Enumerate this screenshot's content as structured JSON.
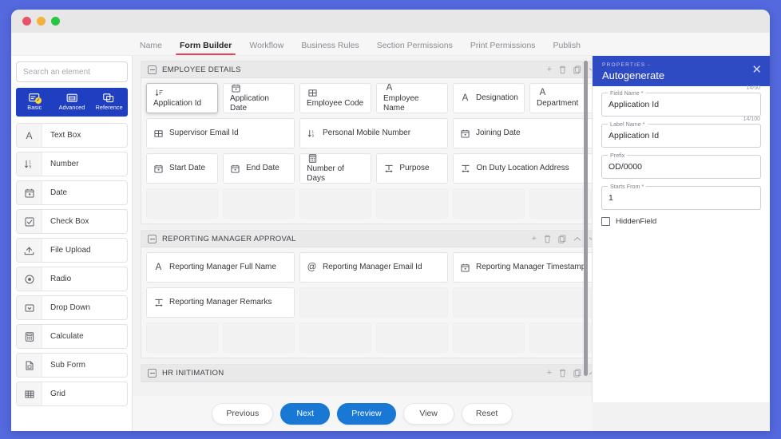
{
  "window": {
    "traffic_lights": [
      "close",
      "minimize",
      "maximize"
    ]
  },
  "tabs": [
    {
      "label": "Name",
      "active": false
    },
    {
      "label": "Form Builder",
      "active": true
    },
    {
      "label": "Workflow",
      "active": false
    },
    {
      "label": "Business Rules",
      "active": false
    },
    {
      "label": "Section Permissions",
      "active": false
    },
    {
      "label": "Print Permissions",
      "active": false
    },
    {
      "label": "Publish",
      "active": false
    }
  ],
  "sidebar": {
    "search": {
      "value": "",
      "placeholder": "Search an element"
    },
    "category_tabs": [
      {
        "label": "Basic",
        "icon": "basic-card-icon",
        "active": true,
        "badge": "✓"
      },
      {
        "label": "Advanced",
        "icon": "advanced-card-icon",
        "active": false
      },
      {
        "label": "Reference",
        "icon": "reference-card-icon",
        "active": false
      }
    ],
    "elements": [
      {
        "label": "Text Box",
        "icon": "letter-a-icon"
      },
      {
        "label": "Number",
        "icon": "number-sort-icon"
      },
      {
        "label": "Date",
        "icon": "calendar-icon"
      },
      {
        "label": "Check Box",
        "icon": "checkbox-icon"
      },
      {
        "label": "File Upload",
        "icon": "upload-icon"
      },
      {
        "label": "Radio",
        "icon": "radio-icon"
      },
      {
        "label": "Drop Down",
        "icon": "dropdown-icon"
      },
      {
        "label": "Calculate",
        "icon": "calculator-icon"
      },
      {
        "label": "Sub Form",
        "icon": "subform-icon"
      },
      {
        "label": "Grid",
        "icon": "grid-icon"
      }
    ]
  },
  "canvas": {
    "sections": [
      {
        "title": "EMPLOYEE DETAILS",
        "actions": [
          "add",
          "delete",
          "copy",
          "chevron-down"
        ],
        "rows": [
          [
            {
              "label": "Application Id",
              "icon": "number-sort-icon",
              "width": "w1",
              "selected": true,
              "stack": true
            },
            {
              "label": "Application Date",
              "icon": "calendar-icon",
              "width": "w1",
              "stack": true
            },
            {
              "label": "Employee Code",
              "icon": "grid-icon",
              "width": "w1",
              "stack": true
            },
            {
              "label": "Employee Name",
              "icon": "letter-a-icon",
              "width": "w1",
              "stack": true
            },
            {
              "label": "Designation",
              "icon": "letter-a-icon",
              "width": "w1"
            },
            {
              "label": "Department",
              "icon": "letter-a-icon",
              "width": "w1",
              "stack": true
            }
          ],
          [
            {
              "label": "Supervisor Email Id",
              "icon": "grid-icon",
              "width": "w2"
            },
            {
              "label": "Personal Mobile Number",
              "icon": "number-sort-icon",
              "width": "w2"
            },
            {
              "label": "Joining Date",
              "icon": "calendar-icon",
              "width": "w2"
            }
          ],
          [
            {
              "label": "Start Date",
              "icon": "calendar-icon",
              "width": "w1"
            },
            {
              "label": "End Date",
              "icon": "calendar-icon",
              "width": "w1"
            },
            {
              "label": "Number of Days",
              "icon": "calculator-icon",
              "width": "w1",
              "stack": true
            },
            {
              "label": "Purpose",
              "icon": "textarea-icon",
              "width": "w1"
            },
            {
              "label": "On Duty Location Address",
              "icon": "textarea-icon",
              "width": "w2"
            }
          ],
          [
            {
              "placeholder": true,
              "width": "w1"
            },
            {
              "placeholder": true,
              "width": "w1"
            },
            {
              "placeholder": true,
              "width": "w1"
            },
            {
              "placeholder": true,
              "width": "w1"
            },
            {
              "placeholder": true,
              "width": "w1"
            },
            {
              "placeholder": true,
              "width": "w1"
            }
          ]
        ]
      },
      {
        "title": "REPORTING MANAGER APPROVAL",
        "actions": [
          "add",
          "delete",
          "copy",
          "chevron-up",
          "chevron-down"
        ],
        "rows": [
          [
            {
              "label": "Reporting Manager Full Name",
              "icon": "letter-a-icon",
              "width": "w2"
            },
            {
              "label": "Reporting Manager Email Id",
              "icon": "at-icon",
              "width": "w2"
            },
            {
              "label": "Reporting Manager Timestamp",
              "icon": "calendar-icon",
              "width": "w2"
            }
          ],
          [
            {
              "label": "Reporting Manager Remarks",
              "icon": "textarea-icon",
              "width": "w2"
            },
            {
              "placeholder": true,
              "width": "w2"
            },
            {
              "placeholder": true,
              "width": "w2"
            }
          ],
          [
            {
              "placeholder": true,
              "width": "w1"
            },
            {
              "placeholder": true,
              "width": "w1"
            },
            {
              "placeholder": true,
              "width": "w1"
            },
            {
              "placeholder": true,
              "width": "w1"
            },
            {
              "placeholder": true,
              "width": "w1"
            },
            {
              "placeholder": true,
              "width": "w1"
            }
          ]
        ]
      },
      {
        "title": "HR INITIMATION",
        "actions": [
          "add",
          "delete",
          "copy",
          "chevron-up"
        ],
        "rows": []
      }
    ]
  },
  "properties": {
    "kicker": "PROPERTIES -",
    "title": "Autogenerate",
    "close_icon": "close-icon",
    "fields": [
      {
        "label": "Field Name *",
        "value": "Application Id",
        "counter": "14/50"
      },
      {
        "label": "Label Name *",
        "value": "Application Id",
        "counter": "14/100"
      },
      {
        "label": "Prefix",
        "value": "OD/0000",
        "counter": ""
      },
      {
        "label": "Starts From *",
        "value": "1",
        "counter": ""
      }
    ],
    "checkbox": {
      "label": "HiddenField",
      "checked": false
    }
  },
  "actionbar": {
    "buttons": [
      {
        "label": "Previous",
        "style": "default"
      },
      {
        "label": "Next",
        "style": "primary"
      },
      {
        "label": "Preview",
        "style": "primary"
      },
      {
        "label": "View",
        "style": "default"
      },
      {
        "label": "Reset",
        "style": "default"
      }
    ]
  },
  "colors": {
    "page_background": "#5369dd",
    "accent_blue": "#1878d4",
    "props_header": "#2f4bc4",
    "sidebar_tabs": "#1f3ec0",
    "active_tab_underline": "#e8445f",
    "badge_yellow": "#fdd63b"
  }
}
